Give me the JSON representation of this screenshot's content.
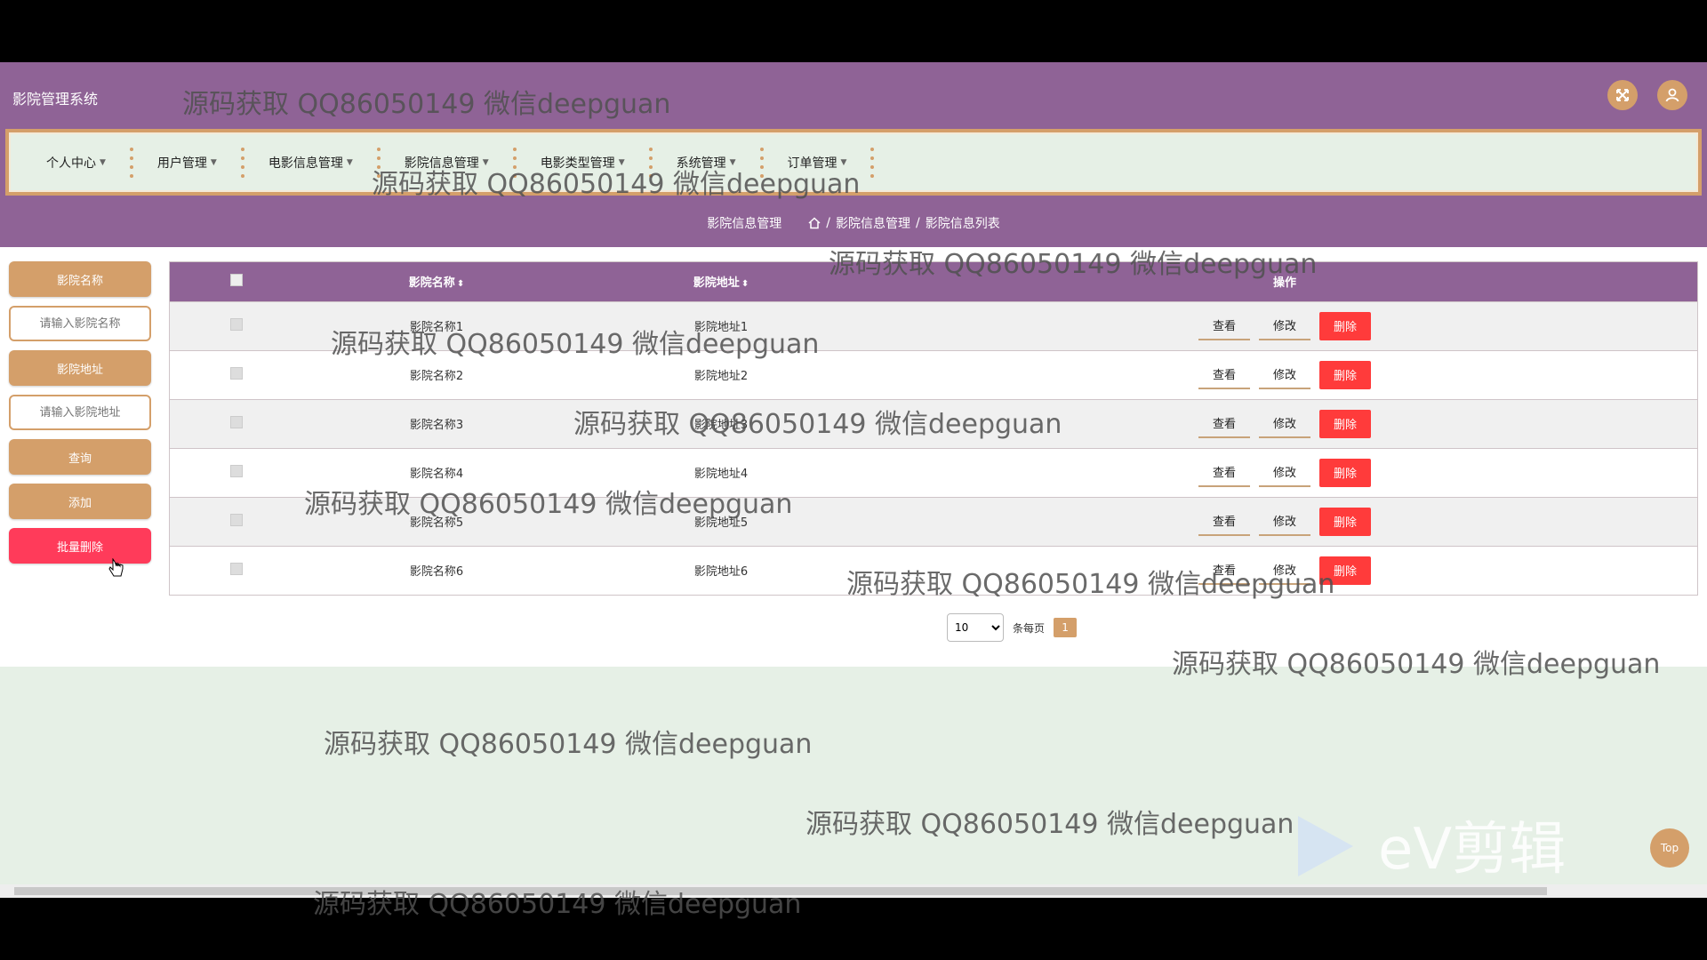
{
  "header": {
    "title": "影院管理系统"
  },
  "nav": {
    "items": [
      {
        "label": "个人中心"
      },
      {
        "label": "用户管理"
      },
      {
        "label": "电影信息管理"
      },
      {
        "label": "影院信息管理"
      },
      {
        "label": "电影类型管理"
      },
      {
        "label": "系统管理"
      },
      {
        "label": "订单管理"
      }
    ]
  },
  "breadcrumb": {
    "current": "影院信息管理",
    "path1": "影院信息管理",
    "path2": "影院信息列表",
    "sep": "/"
  },
  "sidebar": {
    "name_label": "影院名称",
    "name_placeholder": "请输入影院名称",
    "address_label": "影院地址",
    "address_placeholder": "请输入影院地址",
    "search_label": "查询",
    "add_label": "添加",
    "batch_delete_label": "批量删除"
  },
  "table": {
    "headers": {
      "name": "影院名称",
      "address": "影院地址",
      "actions": "操作"
    },
    "view_label": "查看",
    "edit_label": "修改",
    "delete_label": "删除",
    "rows": [
      {
        "name": "影院名称1",
        "address": "影院地址1"
      },
      {
        "name": "影院名称2",
        "address": "影院地址2"
      },
      {
        "name": "影院名称3",
        "address": "影院地址3"
      },
      {
        "name": "影院名称4",
        "address": "影院地址4"
      },
      {
        "name": "影院名称5",
        "address": "影院地址5"
      },
      {
        "name": "影院名称6",
        "address": "影院地址6"
      }
    ]
  },
  "pager": {
    "page_size": "10",
    "per_page_label": "条每页",
    "current_page": "1"
  },
  "top_button": "Top",
  "watermark": "源码获取 QQ86050149 微信deepguan",
  "ev_logo_text": "eV剪辑",
  "colors": {
    "header_purple": "#8f6396",
    "accent_tan": "#d49f6a",
    "danger_red": "#ff3b3b",
    "nav_bg": "#e6f0e6"
  }
}
